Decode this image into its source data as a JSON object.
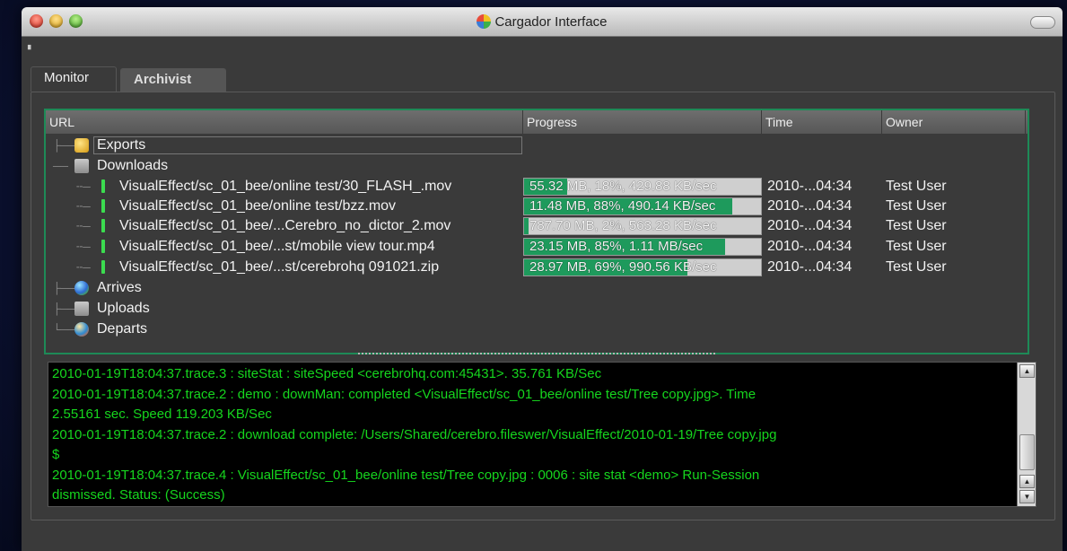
{
  "window": {
    "title": "Cargador Interface"
  },
  "tabs": [
    {
      "label": "Monitor",
      "active": true
    },
    {
      "label": "Archivist",
      "active": false
    }
  ],
  "table": {
    "columns": [
      "URL",
      "Progress",
      "Time",
      "Owner"
    ],
    "groups": {
      "exports": "Exports",
      "downloads": "Downloads",
      "arrives": "Arrives",
      "uploads": "Uploads",
      "departs": "Departs"
    },
    "downloads": [
      {
        "url": "VisualEffect/sc_01_bee/online test/30_FLASH_.mov",
        "progress_text": "55.32 MB, 18%, 429.88 KB/sec",
        "progress_fraction": 0.18,
        "time": "2010-...04:34",
        "owner": "Test User"
      },
      {
        "url": "VisualEffect/sc_01_bee/online test/bzz.mov",
        "progress_text": "11.48 MB, 88%, 490.14 KB/sec",
        "progress_fraction": 0.88,
        "time": "2010-...04:34",
        "owner": "Test User"
      },
      {
        "url": "VisualEffect/sc_01_bee/...Cerebro_no_dictor_2.mov",
        "progress_text": "787.70 MB, 2%, 563.28 KB/sec",
        "progress_fraction": 0.02,
        "time": "2010-...04:34",
        "owner": "Test User"
      },
      {
        "url": "VisualEffect/sc_01_bee/...st/mobile view tour.mp4",
        "progress_text": "23.15 MB, 85%, 1.11 MB/sec",
        "progress_fraction": 0.85,
        "time": "2010-...04:34",
        "owner": "Test User"
      },
      {
        "url": "VisualEffect/sc_01_bee/...st/cerebrohq 091021.zip",
        "progress_text": "28.97 MB, 69%, 990.56 KB/sec",
        "progress_fraction": 0.69,
        "time": "2010-...04:34",
        "owner": "Test User"
      }
    ]
  },
  "console": {
    "lines": [
      "2010-01-19T18:04:37.trace.3 : siteStat : siteSpeed <cerebrohq.com:45431>. 35.761 KB/Sec",
      "2010-01-19T18:04:37.trace.2 : demo : downMan: completed <VisualEffect/sc_01_bee/online test/Tree copy.jpg>. Time",
      "2.55161 sec. Speed 119.203 KB/Sec",
      "2010-01-19T18:04:37.trace.2 : download complete: /Users/Shared/cerebro.fileswer/VisualEffect/2010-01-19/Tree copy.jpg",
      "$",
      "2010-01-19T18:04:37.trace.4 : VisualEffect/sc_01_bee/online test/Tree copy.jpg : 0006 : site stat <demo> Run-Session",
      "dismissed. Status: (Success)"
    ]
  },
  "colors": {
    "accent": "#1e8a57",
    "progress_fill": "#1e9a5c",
    "console_text": "#16d61e"
  }
}
